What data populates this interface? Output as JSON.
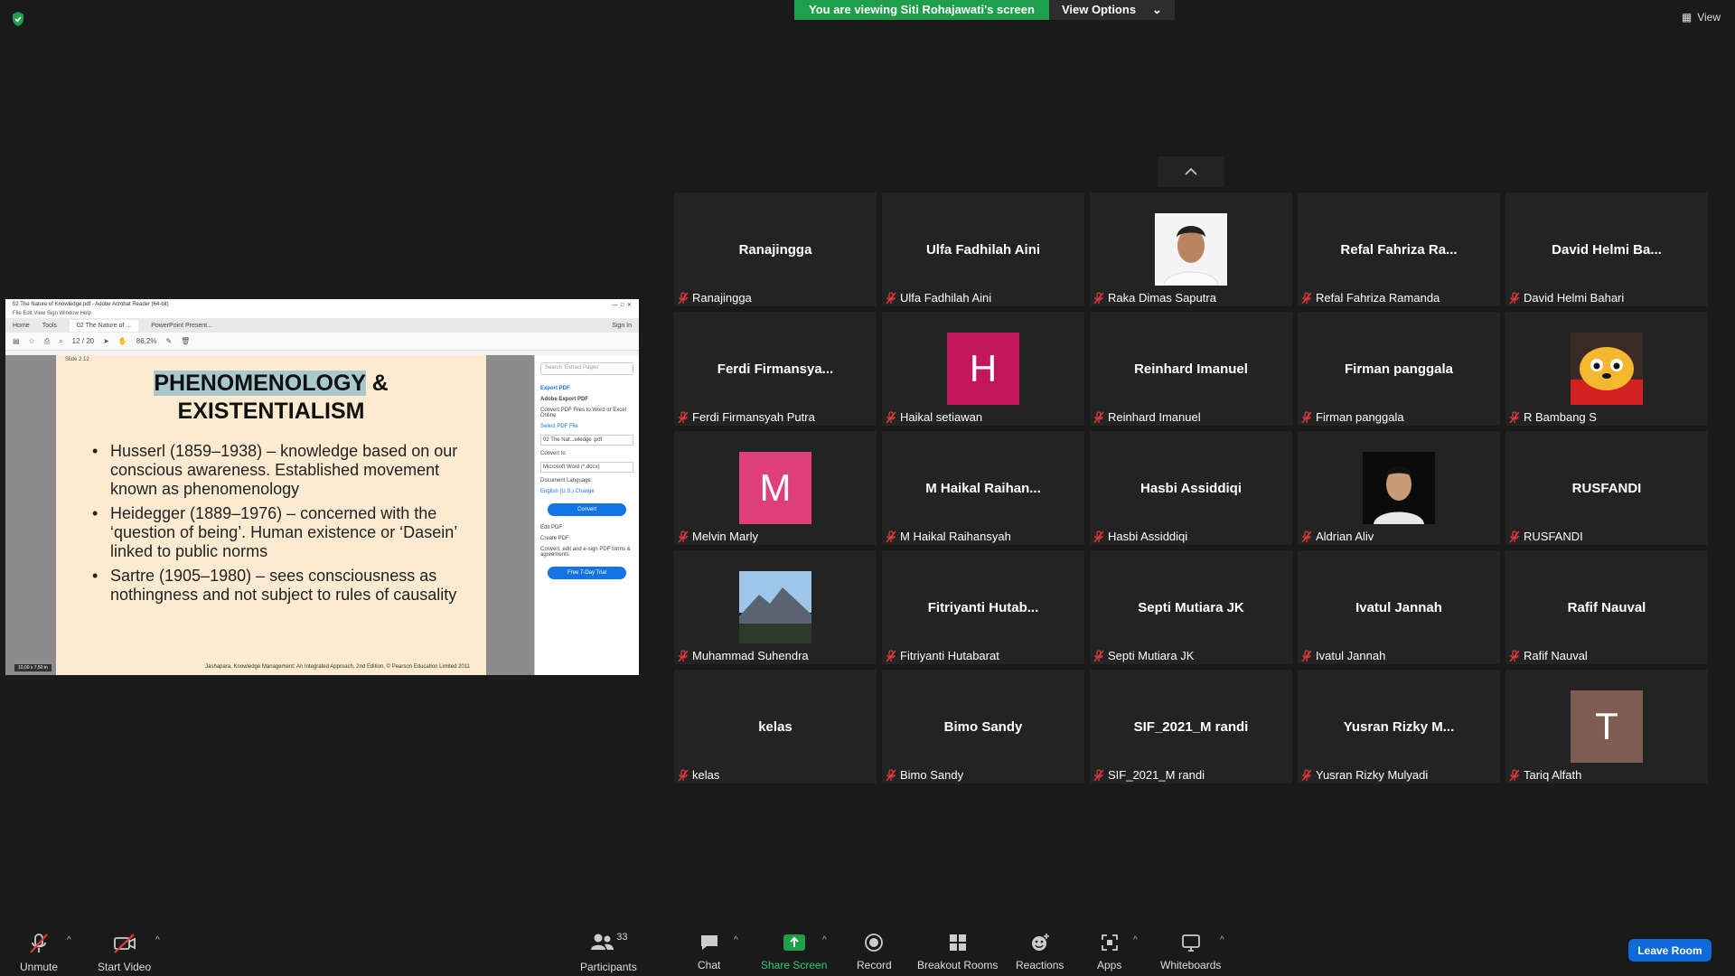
{
  "banner": {
    "viewing": "You are viewing Siti Rohajawati's screen",
    "view_options": "View Options"
  },
  "view_button": "View",
  "share": {
    "window_title": "02 The Nature of Knowledge.pdf - Adobe Acrobat Reader (64-bit)",
    "menu": "File   Edit   View   Sign   Window   Help",
    "tabs": [
      "Home",
      "Tools",
      "02 The Nature of ...",
      "PowerPoint Present..."
    ],
    "sign_in": "Sign In",
    "page": "12 / 20",
    "zoom": "86,2%",
    "slide_number": "Slide 2.12",
    "slide_title_hl": "PHENOMENOLOGY",
    "slide_title_rest": " &",
    "slide_title_line2": "EXISTENTIALISM",
    "bullets": [
      "Husserl (1859–1938) – knowledge based on our conscious awareness. Established movement known as phenomenology",
      "Heidegger (1889–1976) – concerned with the ‘question of being’. Human existence or ‘Dasein’ linked to public norms",
      "Sartre (1905–1980) – sees consciousness as nothingness and not subject to rules of causality"
    ],
    "footer": "Jashapara, Knowledge Management: An Integrated Approach, 2nd Edition, © Pearson Education Limited 2011",
    "dims": "10,00 x 7,50 in",
    "panel": {
      "search": "Search 'Extract Pages'",
      "export": "Export PDF",
      "adobe_export": "Adobe Export PDF",
      "desc": "Convert PDF Files to Word or Excel Online",
      "select": "Select PDF File",
      "file": "02 The Nat...wledge .pdf",
      "convert_to": "Convert to",
      "format": "Microsoft Word (*.docx)",
      "doc_lang": "Document Language:",
      "lang": "English (U.S.)  Change",
      "convert": "Convert",
      "edit_pdf": "Edit PDF",
      "create_pdf": "Create PDF",
      "promo": "Convert, edit and e-sign PDF forms & agreements",
      "trial": "Free 7-Day Trial"
    }
  },
  "participants": [
    {
      "big": "Ranajingga",
      "name": "Ranajingga",
      "type": "text"
    },
    {
      "big": "Ulfa Fadhilah Aini",
      "name": "Ulfa Fadhilah Aini",
      "type": "text"
    },
    {
      "big": "",
      "name": "Raka Dimas Saputra",
      "type": "photo",
      "photo": "portrait-photo-white"
    },
    {
      "big": "Refal Fahriza Ra...",
      "name": "Refal Fahriza Ramanda",
      "type": "text"
    },
    {
      "big": "David Helmi Ba...",
      "name": "David Helmi Bahari",
      "type": "text"
    },
    {
      "big": "Ferdi Firmansya...",
      "name": "Ferdi Firmansyah Putra",
      "type": "text"
    },
    {
      "big": "H",
      "name": "Haikal setiawan",
      "type": "letter",
      "color": "#c2185b"
    },
    {
      "big": "Reinhard Imanuel",
      "name": "Reinhard Imanuel",
      "type": "text"
    },
    {
      "big": "Firman panggala",
      "name": "Firman panggala",
      "type": "text"
    },
    {
      "big": "",
      "name": "R Bambang S",
      "type": "photo",
      "photo": "cartoon-dog-avatar"
    },
    {
      "big": "M",
      "name": "Melvin Marly",
      "type": "letter",
      "color": "#e0407a"
    },
    {
      "big": "M Haikal Raihan...",
      "name": "M Haikal Raihansyah",
      "type": "text"
    },
    {
      "big": "Hasbi Assiddiqi",
      "name": "Hasbi Assiddiqi",
      "type": "text"
    },
    {
      "big": "",
      "name": "Aldrian Aliv",
      "type": "photo",
      "photo": "portrait-photo-dark"
    },
    {
      "big": "RUSFANDI",
      "name": "RUSFANDI",
      "type": "text"
    },
    {
      "big": "",
      "name": "Muhammad Suhendra",
      "type": "photo",
      "photo": "mountain-landscape"
    },
    {
      "big": "Fitriyanti Hutab...",
      "name": "Fitriyanti Hutabarat",
      "type": "text"
    },
    {
      "big": "Septi Mutiara JK",
      "name": "Septi Mutiara JK",
      "type": "text"
    },
    {
      "big": "Ivatul Jannah",
      "name": "Ivatul Jannah",
      "type": "text"
    },
    {
      "big": "Rafif Nauval",
      "name": "Rafif Nauval",
      "type": "text"
    },
    {
      "big": "kelas",
      "name": "kelas",
      "type": "text"
    },
    {
      "big": "Bimo Sandy",
      "name": "Bimo Sandy",
      "type": "text"
    },
    {
      "big": "SIF_2021_M randi",
      "name": "SIF_2021_M randi",
      "type": "text"
    },
    {
      "big": "Yusran Rizky M...",
      "name": "Yusran Rizky Mulyadi",
      "type": "text"
    },
    {
      "big": "T",
      "name": "Tariq Alfath",
      "type": "letter",
      "color": "#7d5c52"
    }
  ],
  "toolbar": {
    "unmute": "Unmute",
    "start_video": "Start Video",
    "participants": "Participants",
    "participants_count": "33",
    "chat": "Chat",
    "share_screen": "Share Screen",
    "record": "Record",
    "breakout": "Breakout Rooms",
    "reactions": "Reactions",
    "apps": "Apps",
    "whiteboards": "Whiteboards",
    "leave": "Leave Room"
  },
  "colors": {
    "share_green": "#1f9e4c",
    "leave_blue": "#0e6ad8",
    "muted_red": "#e03a3a"
  }
}
